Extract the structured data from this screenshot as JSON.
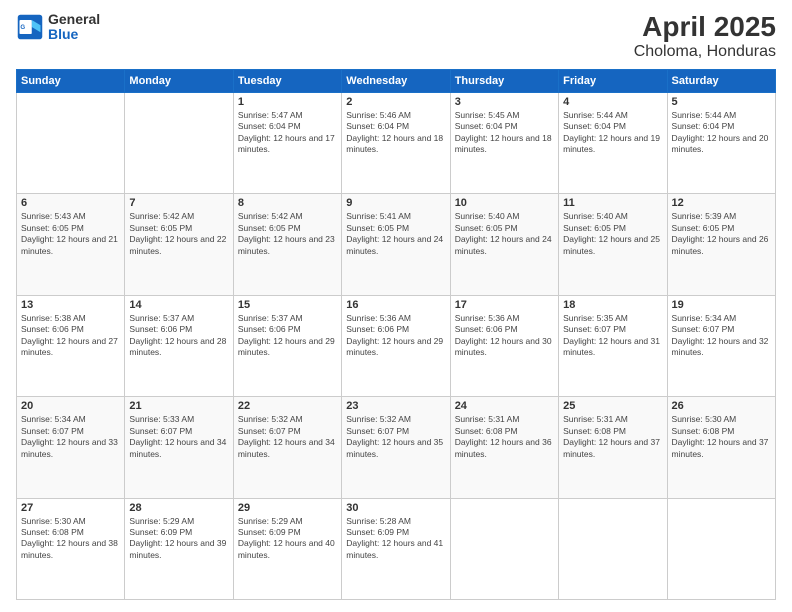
{
  "header": {
    "logo_line1": "General",
    "logo_line2": "Blue",
    "title": "April 2025",
    "subtitle": "Choloma, Honduras"
  },
  "days_of_week": [
    "Sunday",
    "Monday",
    "Tuesday",
    "Wednesday",
    "Thursday",
    "Friday",
    "Saturday"
  ],
  "weeks": [
    [
      {
        "day": "",
        "sunrise": "",
        "sunset": "",
        "daylight": ""
      },
      {
        "day": "",
        "sunrise": "",
        "sunset": "",
        "daylight": ""
      },
      {
        "day": "1",
        "sunrise": "Sunrise: 5:47 AM",
        "sunset": "Sunset: 6:04 PM",
        "daylight": "Daylight: 12 hours and 17 minutes."
      },
      {
        "day": "2",
        "sunrise": "Sunrise: 5:46 AM",
        "sunset": "Sunset: 6:04 PM",
        "daylight": "Daylight: 12 hours and 18 minutes."
      },
      {
        "day": "3",
        "sunrise": "Sunrise: 5:45 AM",
        "sunset": "Sunset: 6:04 PM",
        "daylight": "Daylight: 12 hours and 18 minutes."
      },
      {
        "day": "4",
        "sunrise": "Sunrise: 5:44 AM",
        "sunset": "Sunset: 6:04 PM",
        "daylight": "Daylight: 12 hours and 19 minutes."
      },
      {
        "day": "5",
        "sunrise": "Sunrise: 5:44 AM",
        "sunset": "Sunset: 6:04 PM",
        "daylight": "Daylight: 12 hours and 20 minutes."
      }
    ],
    [
      {
        "day": "6",
        "sunrise": "Sunrise: 5:43 AM",
        "sunset": "Sunset: 6:05 PM",
        "daylight": "Daylight: 12 hours and 21 minutes."
      },
      {
        "day": "7",
        "sunrise": "Sunrise: 5:42 AM",
        "sunset": "Sunset: 6:05 PM",
        "daylight": "Daylight: 12 hours and 22 minutes."
      },
      {
        "day": "8",
        "sunrise": "Sunrise: 5:42 AM",
        "sunset": "Sunset: 6:05 PM",
        "daylight": "Daylight: 12 hours and 23 minutes."
      },
      {
        "day": "9",
        "sunrise": "Sunrise: 5:41 AM",
        "sunset": "Sunset: 6:05 PM",
        "daylight": "Daylight: 12 hours and 24 minutes."
      },
      {
        "day": "10",
        "sunrise": "Sunrise: 5:40 AM",
        "sunset": "Sunset: 6:05 PM",
        "daylight": "Daylight: 12 hours and 24 minutes."
      },
      {
        "day": "11",
        "sunrise": "Sunrise: 5:40 AM",
        "sunset": "Sunset: 6:05 PM",
        "daylight": "Daylight: 12 hours and 25 minutes."
      },
      {
        "day": "12",
        "sunrise": "Sunrise: 5:39 AM",
        "sunset": "Sunset: 6:05 PM",
        "daylight": "Daylight: 12 hours and 26 minutes."
      }
    ],
    [
      {
        "day": "13",
        "sunrise": "Sunrise: 5:38 AM",
        "sunset": "Sunset: 6:06 PM",
        "daylight": "Daylight: 12 hours and 27 minutes."
      },
      {
        "day": "14",
        "sunrise": "Sunrise: 5:37 AM",
        "sunset": "Sunset: 6:06 PM",
        "daylight": "Daylight: 12 hours and 28 minutes."
      },
      {
        "day": "15",
        "sunrise": "Sunrise: 5:37 AM",
        "sunset": "Sunset: 6:06 PM",
        "daylight": "Daylight: 12 hours and 29 minutes."
      },
      {
        "day": "16",
        "sunrise": "Sunrise: 5:36 AM",
        "sunset": "Sunset: 6:06 PM",
        "daylight": "Daylight: 12 hours and 29 minutes."
      },
      {
        "day": "17",
        "sunrise": "Sunrise: 5:36 AM",
        "sunset": "Sunset: 6:06 PM",
        "daylight": "Daylight: 12 hours and 30 minutes."
      },
      {
        "day": "18",
        "sunrise": "Sunrise: 5:35 AM",
        "sunset": "Sunset: 6:07 PM",
        "daylight": "Daylight: 12 hours and 31 minutes."
      },
      {
        "day": "19",
        "sunrise": "Sunrise: 5:34 AM",
        "sunset": "Sunset: 6:07 PM",
        "daylight": "Daylight: 12 hours and 32 minutes."
      }
    ],
    [
      {
        "day": "20",
        "sunrise": "Sunrise: 5:34 AM",
        "sunset": "Sunset: 6:07 PM",
        "daylight": "Daylight: 12 hours and 33 minutes."
      },
      {
        "day": "21",
        "sunrise": "Sunrise: 5:33 AM",
        "sunset": "Sunset: 6:07 PM",
        "daylight": "Daylight: 12 hours and 34 minutes."
      },
      {
        "day": "22",
        "sunrise": "Sunrise: 5:32 AM",
        "sunset": "Sunset: 6:07 PM",
        "daylight": "Daylight: 12 hours and 34 minutes."
      },
      {
        "day": "23",
        "sunrise": "Sunrise: 5:32 AM",
        "sunset": "Sunset: 6:07 PM",
        "daylight": "Daylight: 12 hours and 35 minutes."
      },
      {
        "day": "24",
        "sunrise": "Sunrise: 5:31 AM",
        "sunset": "Sunset: 6:08 PM",
        "daylight": "Daylight: 12 hours and 36 minutes."
      },
      {
        "day": "25",
        "sunrise": "Sunrise: 5:31 AM",
        "sunset": "Sunset: 6:08 PM",
        "daylight": "Daylight: 12 hours and 37 minutes."
      },
      {
        "day": "26",
        "sunrise": "Sunrise: 5:30 AM",
        "sunset": "Sunset: 6:08 PM",
        "daylight": "Daylight: 12 hours and 37 minutes."
      }
    ],
    [
      {
        "day": "27",
        "sunrise": "Sunrise: 5:30 AM",
        "sunset": "Sunset: 6:08 PM",
        "daylight": "Daylight: 12 hours and 38 minutes."
      },
      {
        "day": "28",
        "sunrise": "Sunrise: 5:29 AM",
        "sunset": "Sunset: 6:09 PM",
        "daylight": "Daylight: 12 hours and 39 minutes."
      },
      {
        "day": "29",
        "sunrise": "Sunrise: 5:29 AM",
        "sunset": "Sunset: 6:09 PM",
        "daylight": "Daylight: 12 hours and 40 minutes."
      },
      {
        "day": "30",
        "sunrise": "Sunrise: 5:28 AM",
        "sunset": "Sunset: 6:09 PM",
        "daylight": "Daylight: 12 hours and 41 minutes."
      },
      {
        "day": "",
        "sunrise": "",
        "sunset": "",
        "daylight": ""
      },
      {
        "day": "",
        "sunrise": "",
        "sunset": "",
        "daylight": ""
      },
      {
        "day": "",
        "sunrise": "",
        "sunset": "",
        "daylight": ""
      }
    ]
  ]
}
